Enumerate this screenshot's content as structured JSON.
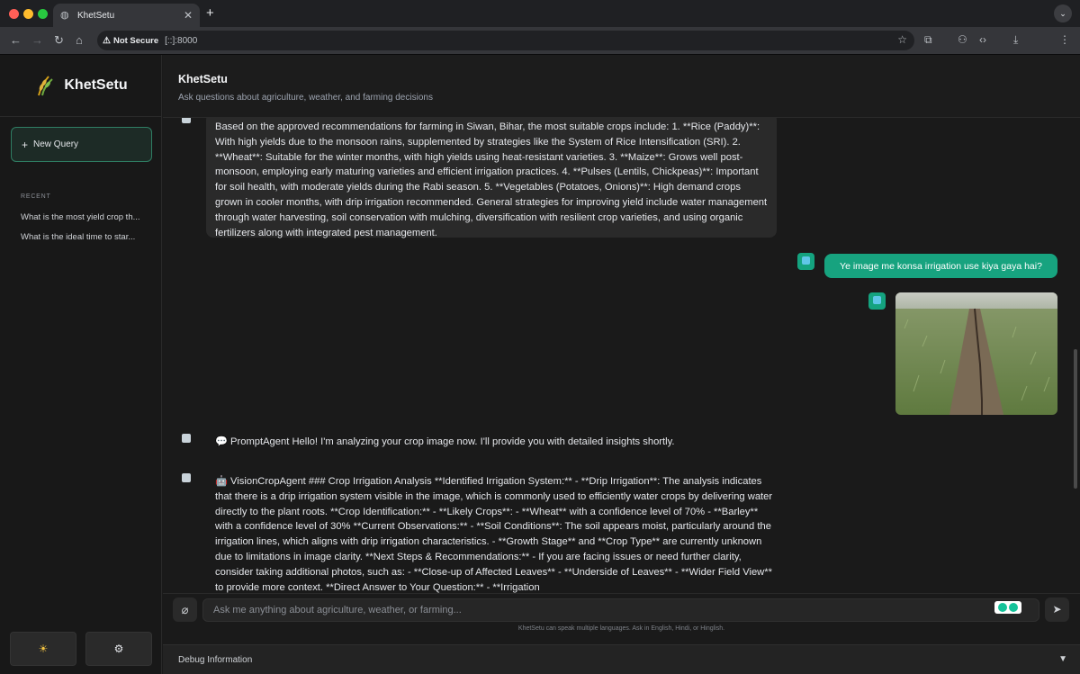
{
  "browser": {
    "tab_title": "KhetSetu",
    "new_tab_icon": "+",
    "security_label": "Not Secure",
    "url": "[::]:8000"
  },
  "sidebar": {
    "brand": "KhetSetu",
    "new_query_label": "New Query",
    "recent_heading": "RECENT",
    "recent_items": [
      "What is the most yield crop th...",
      "What is the ideal time to star..."
    ],
    "theme_icon": "sun-icon",
    "settings_icon": "gear-icon"
  },
  "header": {
    "title": "KhetSetu",
    "subtitle": "Ask questions about agriculture, weather, and farming decisions"
  },
  "messages": {
    "bot_answer": "Based on the approved recommendations for farming in Siwan, Bihar, the most suitable crops include: 1. **Rice (Paddy)**: With high yields due to the monsoon rains, supplemented by strategies like the System of Rice Intensification (SRI). 2. **Wheat**: Suitable for the winter months, with high yields using heat-resistant varieties. 3. **Maize**: Grows well post-monsoon, employing early maturing varieties and efficient irrigation practices. 4. **Pulses (Lentils, Chickpeas)**: Important for soil health, with moderate yields during the Rabi season. 5. **Vegetables (Potatoes, Onions)**: High demand crops grown in cooler months, with drip irrigation recommended. General strategies for improving yield include water management through water harvesting, soil conservation with mulching, diversification with resilient crop varieties, and using organic fertilizers along with integrated pest management.",
    "user_question": "Ye image me konsa irrigation use kiya gaya hai?",
    "prompt_agent": "💬 PromptAgent Hello! I'm analyzing your crop image now. I'll provide you with detailed insights shortly.",
    "vision_agent": "🤖 VisionCropAgent ### Crop Irrigation Analysis **Identified Irrigation System:** - **Drip Irrigation**: The analysis indicates that there is a drip irrigation system visible in the image, which is commonly used to efficiently water crops by delivering water directly to the plant roots. **Crop Identification:** - **Likely Crops**: - **Wheat** with a confidence level of 70% - **Barley** with a confidence level of 30% **Current Observations:** - **Soil Conditions**: The soil appears moist, particularly around the irrigation lines, which aligns with drip irrigation characteristics. - **Growth Stage** and **Crop Type** are currently unknown due to limitations in image clarity. **Next Steps & Recommendations:** - If you are facing issues or need further clarity, consider taking additional photos, such as: - **Close-up of Affected Leaves** - **Underside of Leaves** - **Wider Field View** to provide more context. **Direct Answer to Your Question:** - **Irrigation"
  },
  "composer": {
    "placeholder": "Ask me anything about agriculture, weather, or farming...",
    "hint": "KhetSetu can speak multiple languages. Ask in English, Hindi, or Hinglish."
  },
  "debug": {
    "label": "Debug Information"
  },
  "colors": {
    "accent": "#17a37f",
    "background": "#1a1a1a",
    "bubble": "#2a2a2a"
  }
}
